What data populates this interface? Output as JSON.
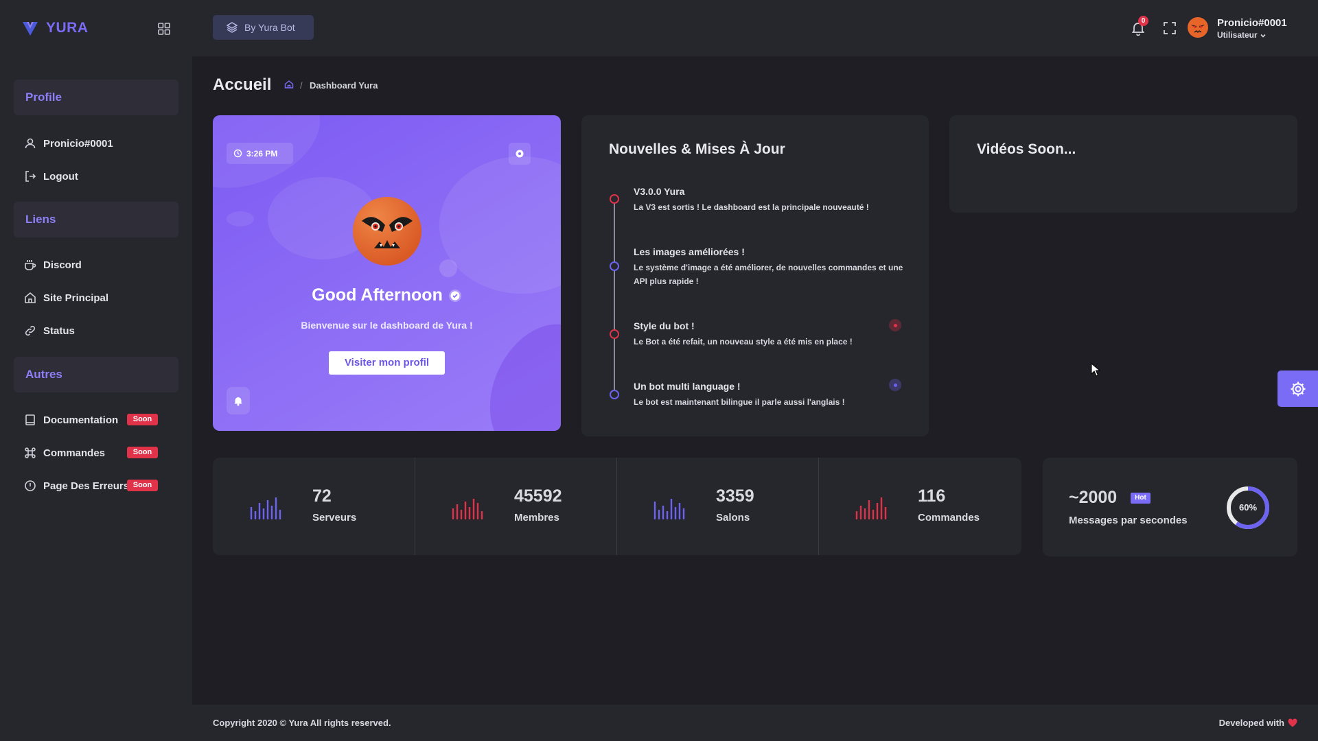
{
  "brand": {
    "name": "YURA",
    "accent": "#7b6cf6"
  },
  "sidebar": {
    "sections": [
      {
        "label": "Profile",
        "items": [
          {
            "label": "Pronicio#0001",
            "icon": "user-icon"
          },
          {
            "label": "Logout",
            "icon": "logout-icon"
          }
        ]
      },
      {
        "label": "Liens",
        "items": [
          {
            "label": "Discord",
            "icon": "coffee-icon"
          },
          {
            "label": "Site Principal",
            "icon": "home-icon"
          },
          {
            "label": "Status",
            "icon": "link-icon"
          }
        ]
      },
      {
        "label": "Autres",
        "items": [
          {
            "label": "Documentation",
            "icon": "book-icon",
            "badge": "Soon"
          },
          {
            "label": "Commandes",
            "icon": "command-icon",
            "badge": "Soon"
          },
          {
            "label": "Page Des Erreurs",
            "icon": "alert-circle-icon",
            "badge": "Soon"
          }
        ]
      }
    ]
  },
  "topbar": {
    "badge_label": "By Yura Bot",
    "notification_count": "0",
    "user": {
      "name": "Pronicio#0001",
      "role": "Utilisateur"
    }
  },
  "page": {
    "title": "Accueil",
    "breadcrumb": [
      "Dashboard Yura"
    ]
  },
  "welcome": {
    "time": "3:26 PM",
    "greeting": "Good Afternoon",
    "subtitle": "Bienvenue sur le dashboard de Yura !",
    "button": "Visiter mon profil"
  },
  "news": {
    "title": "Nouvelles & Mises À Jour",
    "items": [
      {
        "title": "V3.0.0 Yura",
        "desc": "La V3 est sortis ! Le dashboard est la principale nouveauté !",
        "color": "#e0334a"
      },
      {
        "title": "Les images améliorées !",
        "desc": "Le système d'image a été améliorer, de nouvelles commandes et une API plus rapide !",
        "color": "#6c63f0"
      },
      {
        "title": "Style du bot !",
        "desc": "Le Bot a été refait, un nouveau style a été mis en place !",
        "color": "#e0334a"
      },
      {
        "title": "Un bot multi language !",
        "desc": "Le bot est maintenant bilingue il parle aussi l'anglais !",
        "color": "#6c63f0"
      }
    ]
  },
  "videos": {
    "title": "Vidéos Soon..."
  },
  "stats": [
    {
      "value": "72",
      "label": "Serveurs",
      "color": "#6c63f0"
    },
    {
      "value": "45592",
      "label": "Membres",
      "color": "#e0334a"
    },
    {
      "value": "3359",
      "label": "Salons",
      "color": "#6c63f0"
    },
    {
      "value": "116",
      "label": "Commandes",
      "color": "#e0334a"
    }
  ],
  "messages": {
    "value": "~2000",
    "tag": "Hot",
    "label": "Messages par secondes",
    "percent": 60,
    "percent_label": "60%"
  },
  "footer": {
    "copyright": "Copyright 2020 © Yura All rights reserved.",
    "developed": "Developed with"
  }
}
